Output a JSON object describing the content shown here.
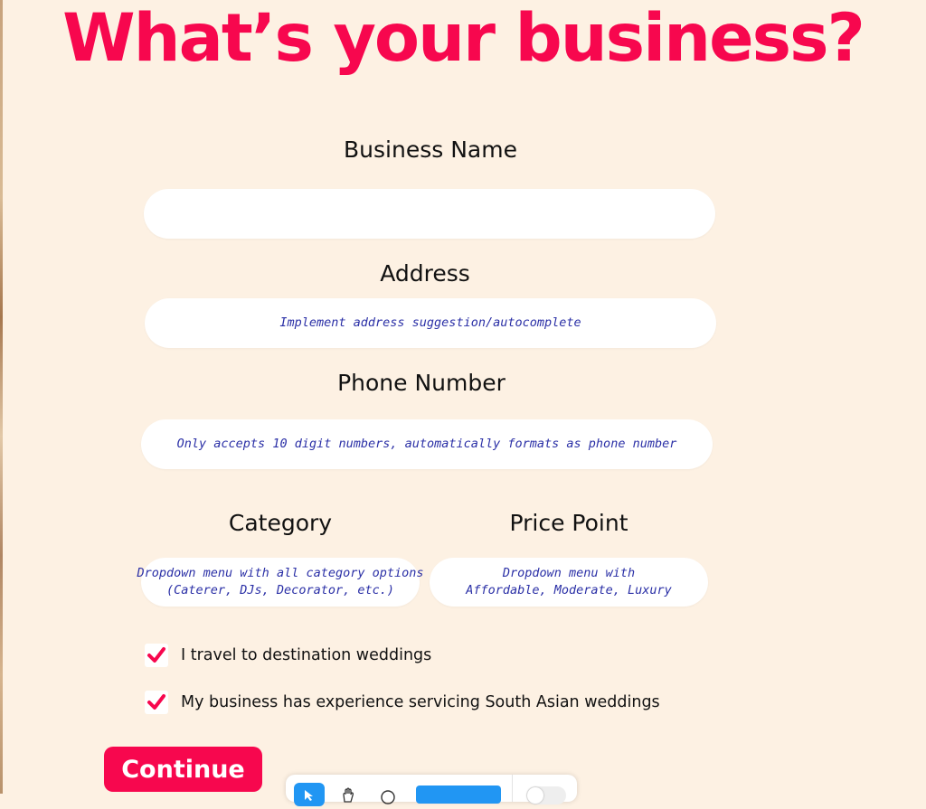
{
  "page": {
    "heading": "What’s your business?"
  },
  "form": {
    "business_name": {
      "label": "Business Name",
      "value": ""
    },
    "address": {
      "label": "Address",
      "note": "Implement address suggestion/autocomplete"
    },
    "phone": {
      "label": "Phone Number",
      "note": "Only accepts 10 digit numbers, automatically formats as phone number"
    },
    "category": {
      "label": "Category",
      "note": "Dropdown menu with all category options\n(Caterer, DJs, Decorator, etc.)"
    },
    "price_point": {
      "label": "Price Point",
      "note": "Dropdown menu with\nAffordable, Moderate, Luxury"
    },
    "checkboxes": [
      {
        "label": "I travel to destination weddings",
        "checked": true
      },
      {
        "label": "My business has experience servicing South Asian weddings",
        "checked": true
      }
    ],
    "continue_label": "Continue"
  },
  "colors": {
    "accent": "#f7074e",
    "background": "#fdf1e3",
    "note_text": "#2a2fa6",
    "toolbar_active": "#2196f3"
  },
  "toolbar": {
    "icons": [
      "cursor-icon",
      "hand-icon",
      "comment-icon",
      "active-tool",
      "toggle"
    ]
  }
}
